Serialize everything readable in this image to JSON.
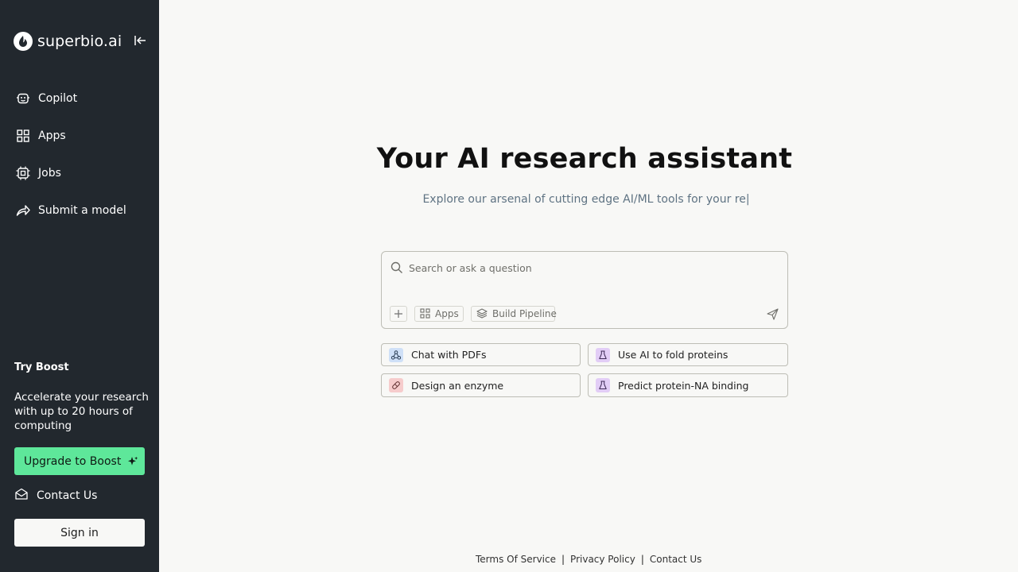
{
  "brand": {
    "name": "superbio.ai"
  },
  "sidebar": {
    "items": [
      {
        "label": "Copilot",
        "icon": "copilot-icon"
      },
      {
        "label": "Apps",
        "icon": "grid-icon"
      },
      {
        "label": "Jobs",
        "icon": "chip-icon"
      },
      {
        "label": "Submit a model",
        "icon": "share-arrow-icon"
      }
    ],
    "boost": {
      "title": "Try Boost",
      "description": "Accelerate your research with up to 20 hours of computing",
      "upgrade_label": "Upgrade to Boost"
    },
    "contact_label": "Contact Us",
    "signin_label": "Sign in"
  },
  "hero": {
    "title": "Your AI research assistant",
    "subtitle": "Explore our arsenal of cutting edge AI/ML tools for your re|"
  },
  "search": {
    "placeholder": "Search or ask a question",
    "value": "",
    "chips": {
      "apps": "Apps",
      "pipeline": "Build Pipeline"
    }
  },
  "suggestions": [
    {
      "label": "Chat with PDFs",
      "icon": "network-icon",
      "icon_bg": "#cfe0f7"
    },
    {
      "label": "Use AI to fold proteins",
      "icon": "flask-icon",
      "icon_bg": "#e2cdf6"
    },
    {
      "label": "Design an enzyme",
      "icon": "pill-icon",
      "icon_bg": "#f6cccc"
    },
    {
      "label": "Predict protein-NA binding",
      "icon": "flask-icon",
      "icon_bg": "#e2cdf6"
    }
  ],
  "footer": {
    "terms": "Terms Of Service",
    "privacy": "Privacy Policy",
    "contact": "Contact Us",
    "separator": "|"
  },
  "colors": {
    "sidebar_bg": "#22282e",
    "page_bg": "#f8f8f6",
    "accent_green": "#5ee79a",
    "subtitle": "#5f7383"
  }
}
